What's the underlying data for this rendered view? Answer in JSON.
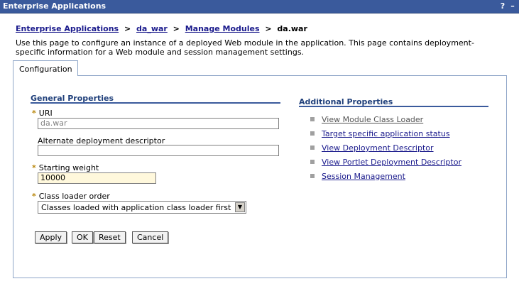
{
  "window": {
    "title": "Enterprise Applications",
    "help_label": "?",
    "min_label": "–"
  },
  "breadcrumb": {
    "items": [
      "Enterprise Applications",
      "da_war",
      "Manage Modules"
    ],
    "separator": ">",
    "current": "da.war"
  },
  "description": "Use this page to configure an instance of a deployed Web module in the application. This page contains deployment-specific information for a Web module and session management settings.",
  "tabs": [
    {
      "label": "Configuration",
      "active": true
    }
  ],
  "general": {
    "title": "General Properties",
    "required_marker": "*",
    "uri": {
      "label": "URI",
      "value": "da.war",
      "required": true,
      "disabled": true
    },
    "alt_dd": {
      "label": "Alternate deployment descriptor",
      "value": ""
    },
    "starting_weight": {
      "label": "Starting weight",
      "value": "10000",
      "required": true
    },
    "class_loader_order": {
      "label": "Class loader order",
      "selected": "Classes loaded with application class loader first",
      "required": true
    }
  },
  "buttons": {
    "apply": "Apply",
    "ok": "OK",
    "reset": "Reset",
    "cancel": "Cancel"
  },
  "additional": {
    "title": "Additional Properties",
    "links": [
      "View Module Class Loader",
      "Target specific application status",
      "View Deployment Descriptor",
      "View Portlet Deployment Descriptor",
      "Session Management"
    ]
  },
  "colors": {
    "titlebar": "#3a5a9c",
    "link": "#1a1a8c",
    "section_title": "#1f3f7a",
    "required": "#b8860b"
  }
}
